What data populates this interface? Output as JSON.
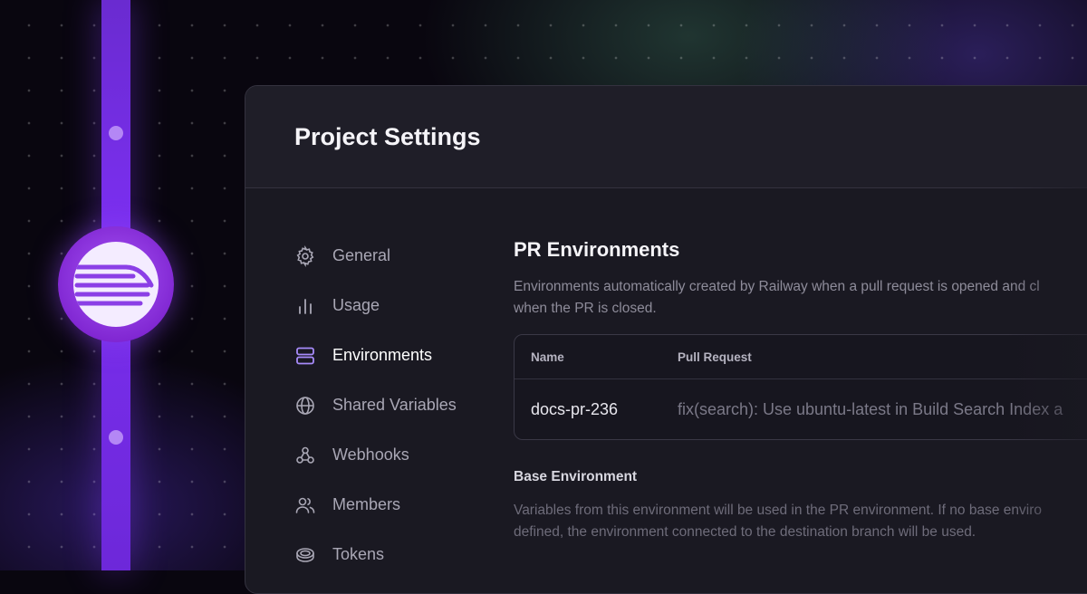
{
  "window": {
    "title": "Project Settings"
  },
  "sidebar": {
    "items": [
      {
        "label": "General",
        "icon": "gear-icon",
        "active": false
      },
      {
        "label": "Usage",
        "icon": "bar-chart-icon",
        "active": false
      },
      {
        "label": "Environments",
        "icon": "server-stack-icon",
        "active": true
      },
      {
        "label": "Shared Variables",
        "icon": "globe-icon",
        "active": false
      },
      {
        "label": "Webhooks",
        "icon": "webhook-icon",
        "active": false
      },
      {
        "label": "Members",
        "icon": "users-icon",
        "active": false
      },
      {
        "label": "Tokens",
        "icon": "coins-icon",
        "active": false
      }
    ]
  },
  "main": {
    "section_title": "PR Environments",
    "description_line1": "Environments automatically created by Railway when a pull request is opened and cl",
    "description_line2": "when the PR is closed.",
    "table": {
      "columns": [
        "Name",
        "Pull Request"
      ],
      "rows": [
        {
          "name": "docs-pr-236",
          "pull_request": "fix(search): Use ubuntu-latest in Build Search Index a"
        }
      ]
    },
    "base_env_title": "Base Environment",
    "base_env_line1": "Variables from this environment will be used in the PR environment. If no base enviro",
    "base_env_line2": "defined, the environment connected to the destination branch will be used."
  },
  "colors": {
    "accent": "#7c3aed",
    "active_icon": "#a78bfa",
    "window_bg": "#1a1922"
  }
}
